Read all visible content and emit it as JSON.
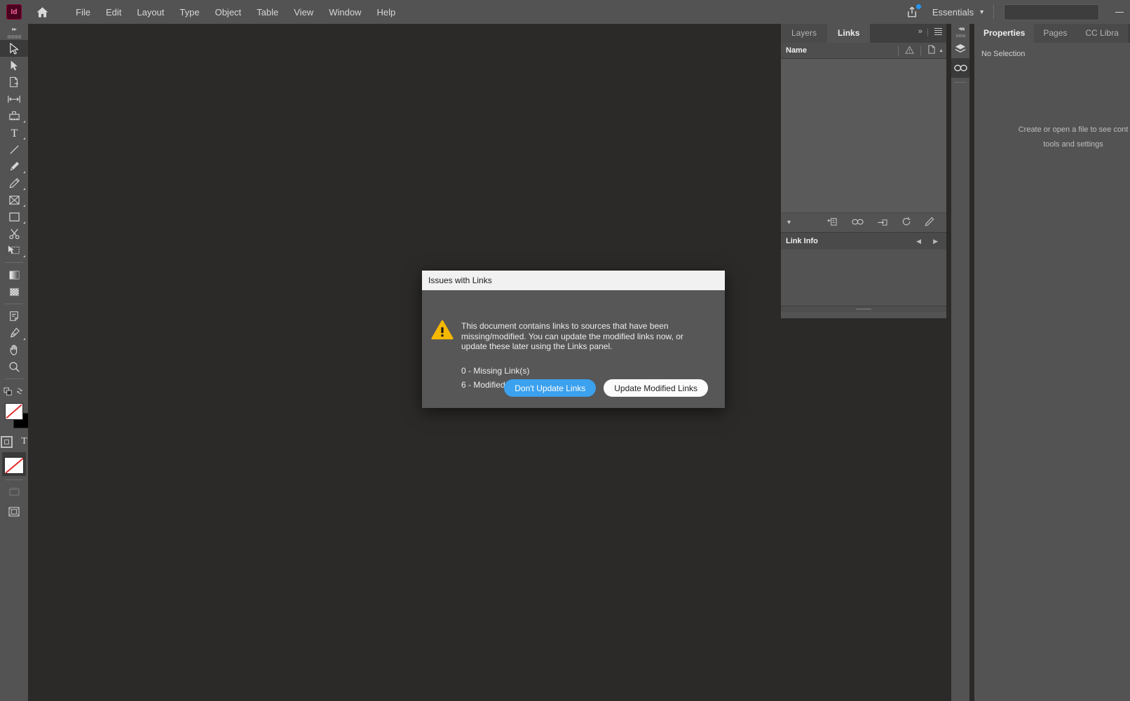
{
  "app": {
    "name": "Adobe InDesign",
    "logo_text": "Id",
    "accent_blue": "#3ca1ee",
    "warning_yellow": "#f5b800",
    "chrome_gray": "#535353",
    "canvas_bg": "#2b2a28"
  },
  "menubar": {
    "home_icon": "home-icon",
    "items": [
      {
        "label": "File"
      },
      {
        "label": "Edit"
      },
      {
        "label": "Layout"
      },
      {
        "label": "Type"
      },
      {
        "label": "Object"
      },
      {
        "label": "Table"
      },
      {
        "label": "View"
      },
      {
        "label": "Window"
      },
      {
        "label": "Help"
      }
    ],
    "share_icon": "share-upload-icon",
    "share_badge": "notification-dot",
    "workspace": "Essentials",
    "workspace_caret": "chevron-down-icon",
    "search_placeholder": "",
    "search_value": "",
    "minimize": "minimize-icon"
  },
  "toolbar": {
    "expand_icon": "double-chevron-right-icon",
    "tools": [
      {
        "name": "selection-tool",
        "icon": "arrow-cursor-icon",
        "active": true,
        "has_flyout": false
      },
      {
        "name": "direct-selection-tool",
        "icon": "solid-arrow-icon",
        "active": false,
        "has_flyout": false
      },
      {
        "name": "page-tool",
        "icon": "page-icon",
        "active": false,
        "has_flyout": false
      },
      {
        "name": "gap-tool",
        "icon": "gap-arrows-icon",
        "active": false,
        "has_flyout": false
      },
      {
        "name": "content-collector-tool",
        "icon": "content-collector-icon",
        "active": false,
        "has_flyout": true
      },
      {
        "name": "type-tool",
        "icon": "type-t-icon",
        "active": false,
        "has_flyout": true
      },
      {
        "name": "line-tool",
        "icon": "line-icon",
        "active": false,
        "has_flyout": false
      },
      {
        "name": "pen-tool",
        "icon": "pen-nib-icon",
        "active": false,
        "has_flyout": true
      },
      {
        "name": "pencil-tool",
        "icon": "pencil-icon",
        "active": false,
        "has_flyout": true
      },
      {
        "name": "frame-tool",
        "icon": "rectangle-frame-icon",
        "active": false,
        "has_flyout": true
      },
      {
        "name": "rectangle-tool",
        "icon": "rectangle-icon",
        "active": false,
        "has_flyout": true
      },
      {
        "name": "scissors-tool",
        "icon": "scissors-icon",
        "active": false,
        "has_flyout": false
      },
      {
        "name": "free-transform-tool",
        "icon": "free-transform-icon",
        "active": false,
        "has_flyout": true
      },
      {
        "name": "gradient-swatch-tool",
        "icon": "gradient-icon",
        "active": false,
        "has_flyout": false
      },
      {
        "name": "gradient-feather-tool",
        "icon": "gradient-feather-icon",
        "active": false,
        "has_flyout": false
      },
      {
        "name": "note-tool",
        "icon": "note-icon",
        "active": false,
        "has_flyout": false
      },
      {
        "name": "eyedropper-tool",
        "icon": "eyedropper-icon",
        "active": false,
        "has_flyout": true
      },
      {
        "name": "hand-tool",
        "icon": "hand-icon",
        "active": false,
        "has_flyout": false
      },
      {
        "name": "zoom-tool",
        "icon": "magnifier-icon",
        "active": false,
        "has_flyout": false
      }
    ],
    "fill_stroke": {
      "swap_icon": "swap-fill-stroke-icon",
      "default_icon": "default-fill-stroke-icon",
      "fill_color": "#ffffff",
      "stroke_color": "#000000",
      "fill_is_none": true
    },
    "formatting": {
      "container_icon": "formatting-affects-container-icon",
      "text_icon": "formatting-affects-text-icon"
    },
    "apply_none": {
      "icon": "apply-none-icon",
      "selected": true
    },
    "screen_mode": {
      "icon": "screen-mode-icon"
    },
    "preview_mode": {
      "icon": "preview-mode-icon"
    }
  },
  "links_panel": {
    "tabs": [
      {
        "label": "Layers",
        "active": false
      },
      {
        "label": "Links",
        "active": true
      }
    ],
    "collapse_icon": "double-chevron-right-icon",
    "menu_icon": "panel-menu-icon",
    "columns": [
      {
        "label": "Name",
        "type": "text"
      },
      {
        "label": "",
        "icon": "warning-triangle-icon"
      },
      {
        "label": "",
        "icon": "page-number-icon"
      }
    ],
    "sort_icon": "sort-caret-icon",
    "rows": [],
    "footer_icons": [
      {
        "name": "relink-icon"
      },
      {
        "name": "go-to-link-icon"
      },
      {
        "name": "update-link-icon"
      },
      {
        "name": "refresh-link-icon"
      },
      {
        "name": "edit-original-icon"
      }
    ],
    "expand_icon": "chevron-down-icon",
    "link_info": {
      "title": "Link Info",
      "prev_icon": "left-caret-icon",
      "next_icon": "right-caret-icon",
      "content": ""
    }
  },
  "icon_rail": {
    "collapse_icon": "double-chevron-left-icon",
    "buttons": [
      {
        "name": "layers-rail-button",
        "icon": "layers-stack-icon",
        "active": false
      },
      {
        "name": "links-rail-button",
        "icon": "link-chain-icon",
        "active": true
      }
    ]
  },
  "properties_panel": {
    "tabs": [
      {
        "label": "Properties",
        "active": true
      },
      {
        "label": "Pages",
        "active": false
      },
      {
        "label": "CC Libra",
        "active": false
      }
    ],
    "selection_status": "No Selection",
    "hint_line1": "Create or open a file to see cont",
    "hint_line2": "tools and settings"
  },
  "dialog": {
    "title": "Issues with Links",
    "warning_icon": "warning-triangle-icon",
    "message": "This document contains links to sources that have been missing/modified. You can update the modified links now, or update these later using the Links panel.",
    "counts": [
      "0 - Missing Link(s)",
      "6 - Modified Link(s)"
    ],
    "buttons": {
      "primary": "Don't Update Links",
      "secondary": "Update Modified Links"
    }
  }
}
